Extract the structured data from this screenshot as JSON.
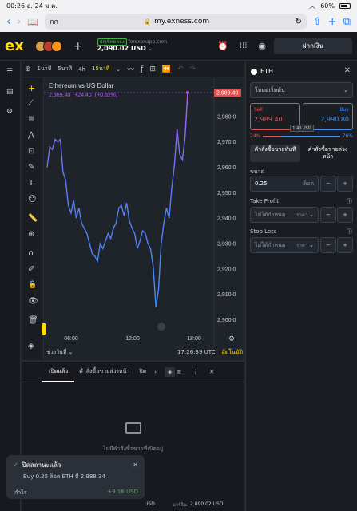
{
  "status_bar": {
    "time": "00:26",
    "date": "อ. 24 ม.ค.",
    "battery": "60%"
  },
  "browser": {
    "tab_label": "กก",
    "url": "my.exness.com"
  },
  "app": {
    "logo": "ex",
    "account_type": "บัญชีทดลอง",
    "account_name": "forexonapp.com",
    "balance": "2,090.02 USD",
    "deposit_label": "ฝากเงิน"
  },
  "chart_toolbar": {
    "tf_1m": "1นาที",
    "tf_5m": "5นาที",
    "tf_4h": "4h",
    "tf_15m": "15นาที"
  },
  "chart": {
    "title": "Ethereum vs US Dollar",
    "price_line": "2,989.40",
    "change": "+24.40",
    "change_pct": "(+0.82%)",
    "current_price_tag": "2,989.40",
    "time_range_label": "ช่วงวันที่",
    "clock": "17:26:39 UTC",
    "auto_label": "อัตโนมัติ"
  },
  "chart_data": {
    "type": "line",
    "x_ticks": [
      "06:00",
      "12:00",
      "18:00"
    ],
    "y_ticks": [
      2980.0,
      2970.0,
      2960.0,
      2950.0,
      2940.0,
      2930.0,
      2920.0,
      2910.0,
      2900.0
    ],
    "ylim": [
      2897,
      2985
    ],
    "series": [
      {
        "values": [
          2960,
          2968,
          2967,
          2971,
          2970,
          2971,
          2958,
          2955,
          2945,
          2942,
          2947,
          2940,
          2944,
          2938,
          2936,
          2934,
          2930,
          2926,
          2925,
          2923,
          2930,
          2928,
          2931,
          2934,
          2932,
          2936,
          2938,
          2944,
          2945,
          2941,
          2946,
          2939,
          2936,
          2934,
          2928,
          2931,
          2935,
          2934,
          2930,
          2928,
          2921,
          2905,
          2912,
          2930,
          2938,
          2944,
          2940,
          2952,
          2961,
          2975,
          2965,
          2963,
          2972,
          2989.4
        ]
      }
    ],
    "last_price": 2989.4
  },
  "order_panel": {
    "symbol": "ETH",
    "mode": "โหมดเริ่มต้น",
    "sell_label": "Sell",
    "sell_price": "2,989.40",
    "buy_label": "Buy",
    "buy_price": "2,990.80",
    "spread": "1.40 USD",
    "sell_pct": "24%",
    "buy_pct": "76%",
    "tab_instant": "คำสั่งซื้อขายทันที",
    "tab_pending": "คำสั่งซื้อขายล่วงหน้า",
    "volume_label": "ขนาด",
    "volume_value": "0.25",
    "volume_unit": "ล็อต",
    "tp_label": "Take Profit",
    "tp_placeholder": "ไม่ได้กำหนด",
    "tp_unit": "ราคา",
    "sl_label": "Stop Loss",
    "sl_placeholder": "ไม่ได้กำหนด",
    "sl_unit": "ราคา"
  },
  "positions": {
    "tab_open": "เปิดแล้ว",
    "tab_pending": "คำสั่งซื้อขายล่วงหน้า",
    "tab_closed": "ปิด",
    "empty_text": "ไม่มีคำสั่งซื้อขายที่เปิดอยู่"
  },
  "toast": {
    "title": "ปิดสถานะแล้ว",
    "message": "Buy 0.25 ล็อต ETH ที่ 2,988.34",
    "profit_label": "กำไร",
    "profit_value": "+9.16 USD"
  },
  "footer": {
    "currency": "USD",
    "balance_label": "มาร์จิน",
    "balance_value": "2,090.02 USD"
  },
  "colors": {
    "accent": "#ffde02",
    "buy": "#3f8df7",
    "sell": "#e05252",
    "line_low": "#3f8df7",
    "line_high": "#b15cf0"
  }
}
